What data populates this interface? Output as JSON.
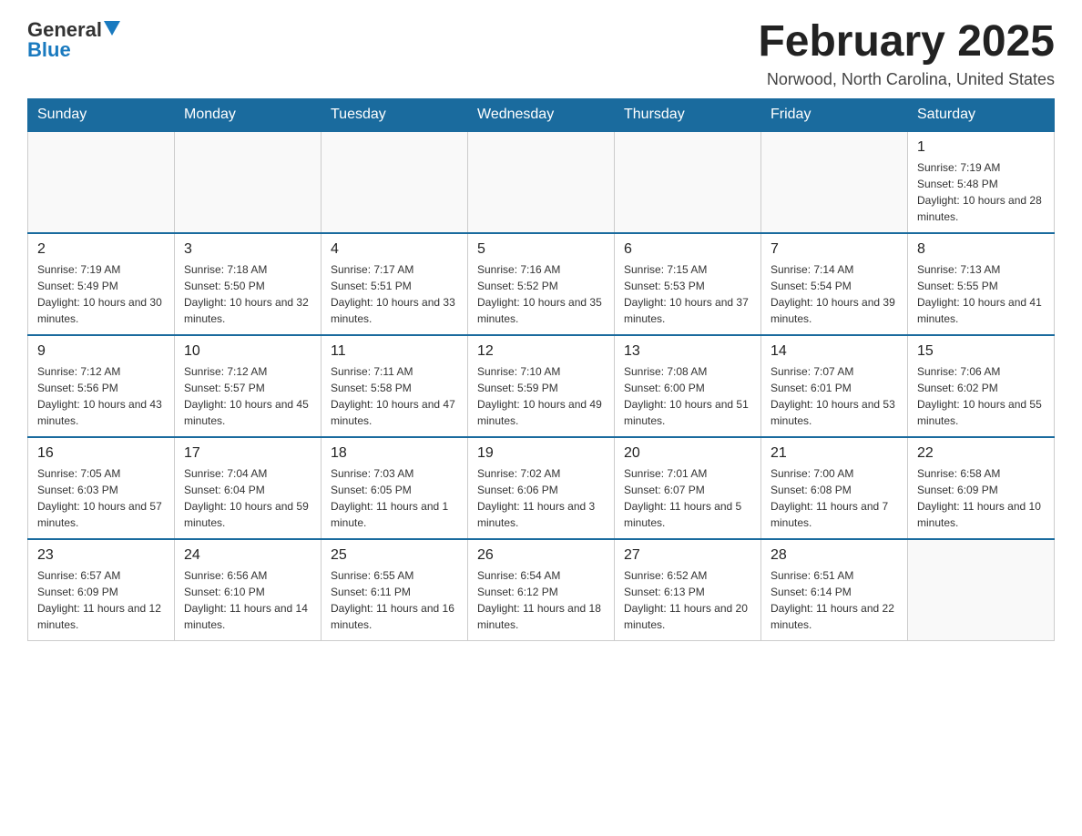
{
  "header": {
    "logo": {
      "general": "General",
      "blue": "Blue"
    },
    "title": "February 2025",
    "location": "Norwood, North Carolina, United States"
  },
  "calendar": {
    "days_of_week": [
      "Sunday",
      "Monday",
      "Tuesday",
      "Wednesday",
      "Thursday",
      "Friday",
      "Saturday"
    ],
    "weeks": [
      [
        {
          "day": "",
          "info": ""
        },
        {
          "day": "",
          "info": ""
        },
        {
          "day": "",
          "info": ""
        },
        {
          "day": "",
          "info": ""
        },
        {
          "day": "",
          "info": ""
        },
        {
          "day": "",
          "info": ""
        },
        {
          "day": "1",
          "info": "Sunrise: 7:19 AM\nSunset: 5:48 PM\nDaylight: 10 hours and 28 minutes."
        }
      ],
      [
        {
          "day": "2",
          "info": "Sunrise: 7:19 AM\nSunset: 5:49 PM\nDaylight: 10 hours and 30 minutes."
        },
        {
          "day": "3",
          "info": "Sunrise: 7:18 AM\nSunset: 5:50 PM\nDaylight: 10 hours and 32 minutes."
        },
        {
          "day": "4",
          "info": "Sunrise: 7:17 AM\nSunset: 5:51 PM\nDaylight: 10 hours and 33 minutes."
        },
        {
          "day": "5",
          "info": "Sunrise: 7:16 AM\nSunset: 5:52 PM\nDaylight: 10 hours and 35 minutes."
        },
        {
          "day": "6",
          "info": "Sunrise: 7:15 AM\nSunset: 5:53 PM\nDaylight: 10 hours and 37 minutes."
        },
        {
          "day": "7",
          "info": "Sunrise: 7:14 AM\nSunset: 5:54 PM\nDaylight: 10 hours and 39 minutes."
        },
        {
          "day": "8",
          "info": "Sunrise: 7:13 AM\nSunset: 5:55 PM\nDaylight: 10 hours and 41 minutes."
        }
      ],
      [
        {
          "day": "9",
          "info": "Sunrise: 7:12 AM\nSunset: 5:56 PM\nDaylight: 10 hours and 43 minutes."
        },
        {
          "day": "10",
          "info": "Sunrise: 7:12 AM\nSunset: 5:57 PM\nDaylight: 10 hours and 45 minutes."
        },
        {
          "day": "11",
          "info": "Sunrise: 7:11 AM\nSunset: 5:58 PM\nDaylight: 10 hours and 47 minutes."
        },
        {
          "day": "12",
          "info": "Sunrise: 7:10 AM\nSunset: 5:59 PM\nDaylight: 10 hours and 49 minutes."
        },
        {
          "day": "13",
          "info": "Sunrise: 7:08 AM\nSunset: 6:00 PM\nDaylight: 10 hours and 51 minutes."
        },
        {
          "day": "14",
          "info": "Sunrise: 7:07 AM\nSunset: 6:01 PM\nDaylight: 10 hours and 53 minutes."
        },
        {
          "day": "15",
          "info": "Sunrise: 7:06 AM\nSunset: 6:02 PM\nDaylight: 10 hours and 55 minutes."
        }
      ],
      [
        {
          "day": "16",
          "info": "Sunrise: 7:05 AM\nSunset: 6:03 PM\nDaylight: 10 hours and 57 minutes."
        },
        {
          "day": "17",
          "info": "Sunrise: 7:04 AM\nSunset: 6:04 PM\nDaylight: 10 hours and 59 minutes."
        },
        {
          "day": "18",
          "info": "Sunrise: 7:03 AM\nSunset: 6:05 PM\nDaylight: 11 hours and 1 minute."
        },
        {
          "day": "19",
          "info": "Sunrise: 7:02 AM\nSunset: 6:06 PM\nDaylight: 11 hours and 3 minutes."
        },
        {
          "day": "20",
          "info": "Sunrise: 7:01 AM\nSunset: 6:07 PM\nDaylight: 11 hours and 5 minutes."
        },
        {
          "day": "21",
          "info": "Sunrise: 7:00 AM\nSunset: 6:08 PM\nDaylight: 11 hours and 7 minutes."
        },
        {
          "day": "22",
          "info": "Sunrise: 6:58 AM\nSunset: 6:09 PM\nDaylight: 11 hours and 10 minutes."
        }
      ],
      [
        {
          "day": "23",
          "info": "Sunrise: 6:57 AM\nSunset: 6:09 PM\nDaylight: 11 hours and 12 minutes."
        },
        {
          "day": "24",
          "info": "Sunrise: 6:56 AM\nSunset: 6:10 PM\nDaylight: 11 hours and 14 minutes."
        },
        {
          "day": "25",
          "info": "Sunrise: 6:55 AM\nSunset: 6:11 PM\nDaylight: 11 hours and 16 minutes."
        },
        {
          "day": "26",
          "info": "Sunrise: 6:54 AM\nSunset: 6:12 PM\nDaylight: 11 hours and 18 minutes."
        },
        {
          "day": "27",
          "info": "Sunrise: 6:52 AM\nSunset: 6:13 PM\nDaylight: 11 hours and 20 minutes."
        },
        {
          "day": "28",
          "info": "Sunrise: 6:51 AM\nSunset: 6:14 PM\nDaylight: 11 hours and 22 minutes."
        },
        {
          "day": "",
          "info": ""
        }
      ]
    ]
  }
}
